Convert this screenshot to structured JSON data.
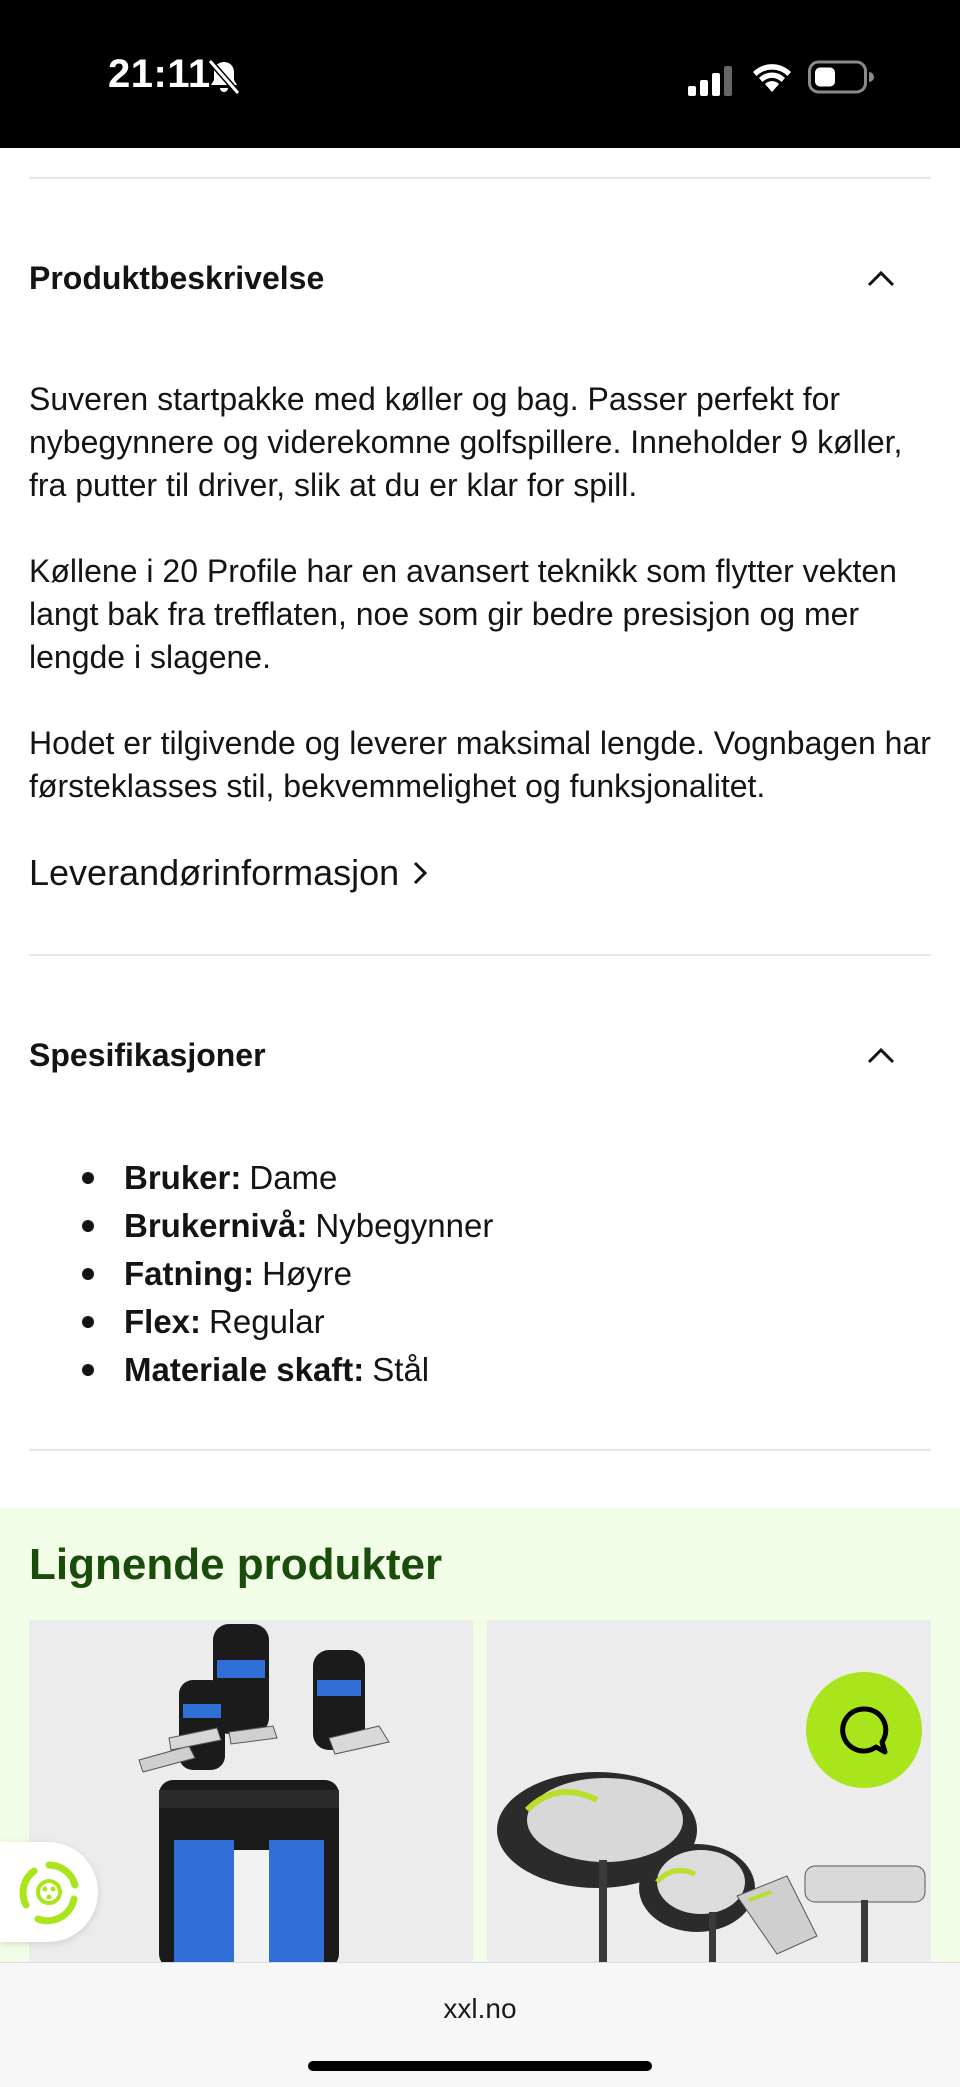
{
  "status_bar": {
    "time": "21:11",
    "icons": [
      "bell-slash-icon",
      "signal-icon",
      "wifi-icon",
      "battery-icon"
    ]
  },
  "description_section": {
    "title": "Produktbeskrivelse",
    "paragraphs": [
      "Suveren startpakke med køller og bag. Passer perfekt for nybegynnere og viderekomne golfspillere. Inneholder 9 køller, fra putter til driver, slik at du er klar for spill.",
      "Køllene i 20 Profile har en avansert teknikk som flytter vekten langt bak fra trefflaten, noe som gir bedre presisjon og mer lengde i slagene.",
      "Hodet er tilgivende og leverer maksimal lengde. Vognbagen har førsteklasses stil, bekvemmelighet og funksjonalitet."
    ],
    "supplier_link": "Leverandørinformasjon"
  },
  "specs_section": {
    "title": "Spesifikasjoner",
    "items": [
      {
        "label": "Bruker:",
        "value": "Dame"
      },
      {
        "label": "Brukernivå:",
        "value": "Nybegynner"
      },
      {
        "label": "Fatning:",
        "value": "Høyre"
      },
      {
        "label": "Flex:",
        "value": "Regular"
      },
      {
        "label": "Materiale skaft:",
        "value": "Stål"
      }
    ]
  },
  "similar_products": {
    "title": "Lignende produkter"
  },
  "browser": {
    "url": "xxl.no"
  },
  "colors": {
    "accent_green": "#a9e51b",
    "heading_green": "#1a4d0b",
    "similar_bg": "#f1fde6"
  }
}
